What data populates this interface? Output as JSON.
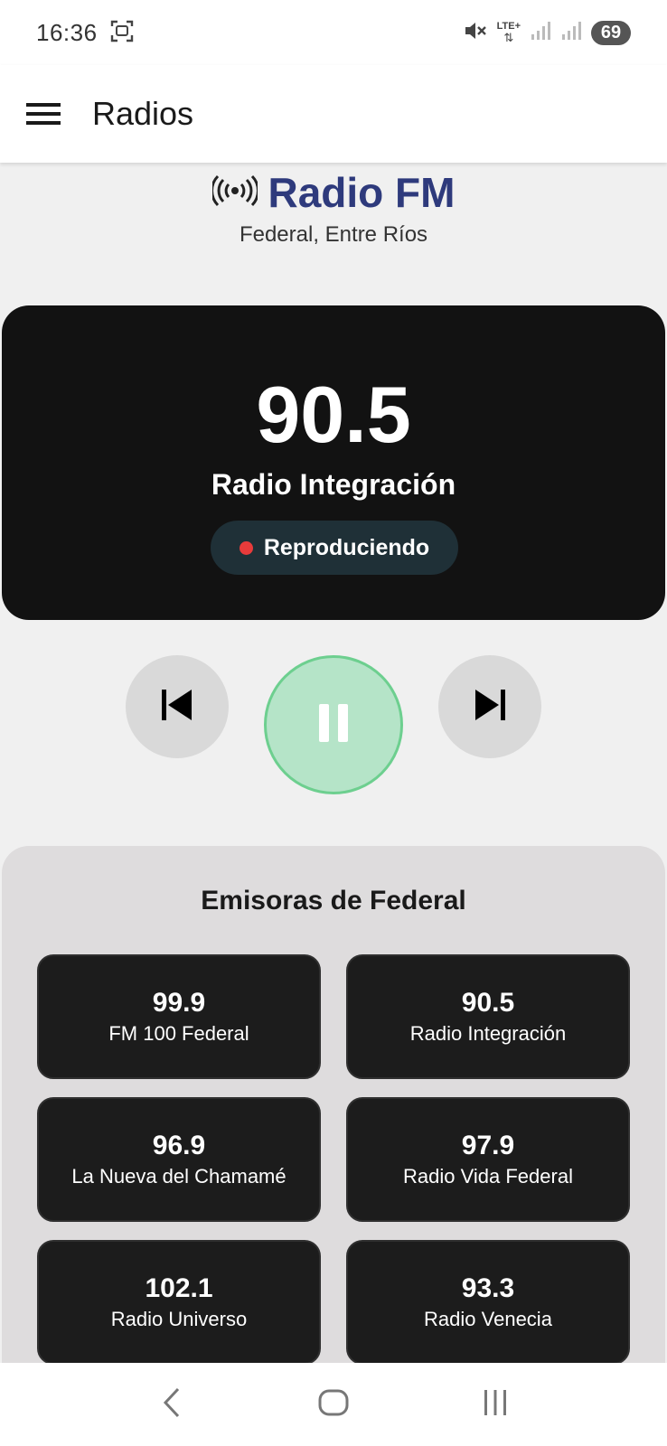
{
  "status_bar": {
    "time": "16:36",
    "network_label": "LTE+",
    "battery": "69",
    "icons": [
      "screenshot-icon",
      "mute-icon",
      "signal-icon",
      "signal-icon-2"
    ]
  },
  "app_bar": {
    "title": "Radios",
    "menu_icon": "hamburger-menu-icon"
  },
  "header": {
    "icon": "broadcast-icon",
    "title": "Radio FM",
    "location": "Federal, Entre Ríos",
    "title_color": "#2e3a7c"
  },
  "now_playing": {
    "frequency": "90.5",
    "station_name": "Radio Integración",
    "status": "Reproduciendo",
    "status_dot_color": "#e83b3b"
  },
  "controls": {
    "previous_icon": "skip-previous-icon",
    "pause_icon": "pause-icon",
    "next_icon": "skip-next-icon",
    "play_color": "#b5e4c8"
  },
  "stations": {
    "title": "Emisoras de Federal",
    "items": [
      {
        "frequency": "99.9",
        "name": "FM 100 Federal"
      },
      {
        "frequency": "90.5",
        "name": "Radio Integración"
      },
      {
        "frequency": "96.9",
        "name": "La Nueva del Chamamé"
      },
      {
        "frequency": "97.9",
        "name": "Radio Vida Federal"
      },
      {
        "frequency": "102.1",
        "name": "Radio Universo"
      },
      {
        "frequency": "93.3",
        "name": "Radio Venecia"
      }
    ]
  },
  "nav_bar": {
    "back_icon": "back-icon",
    "home_icon": "home-icon",
    "recents_icon": "recents-icon"
  }
}
